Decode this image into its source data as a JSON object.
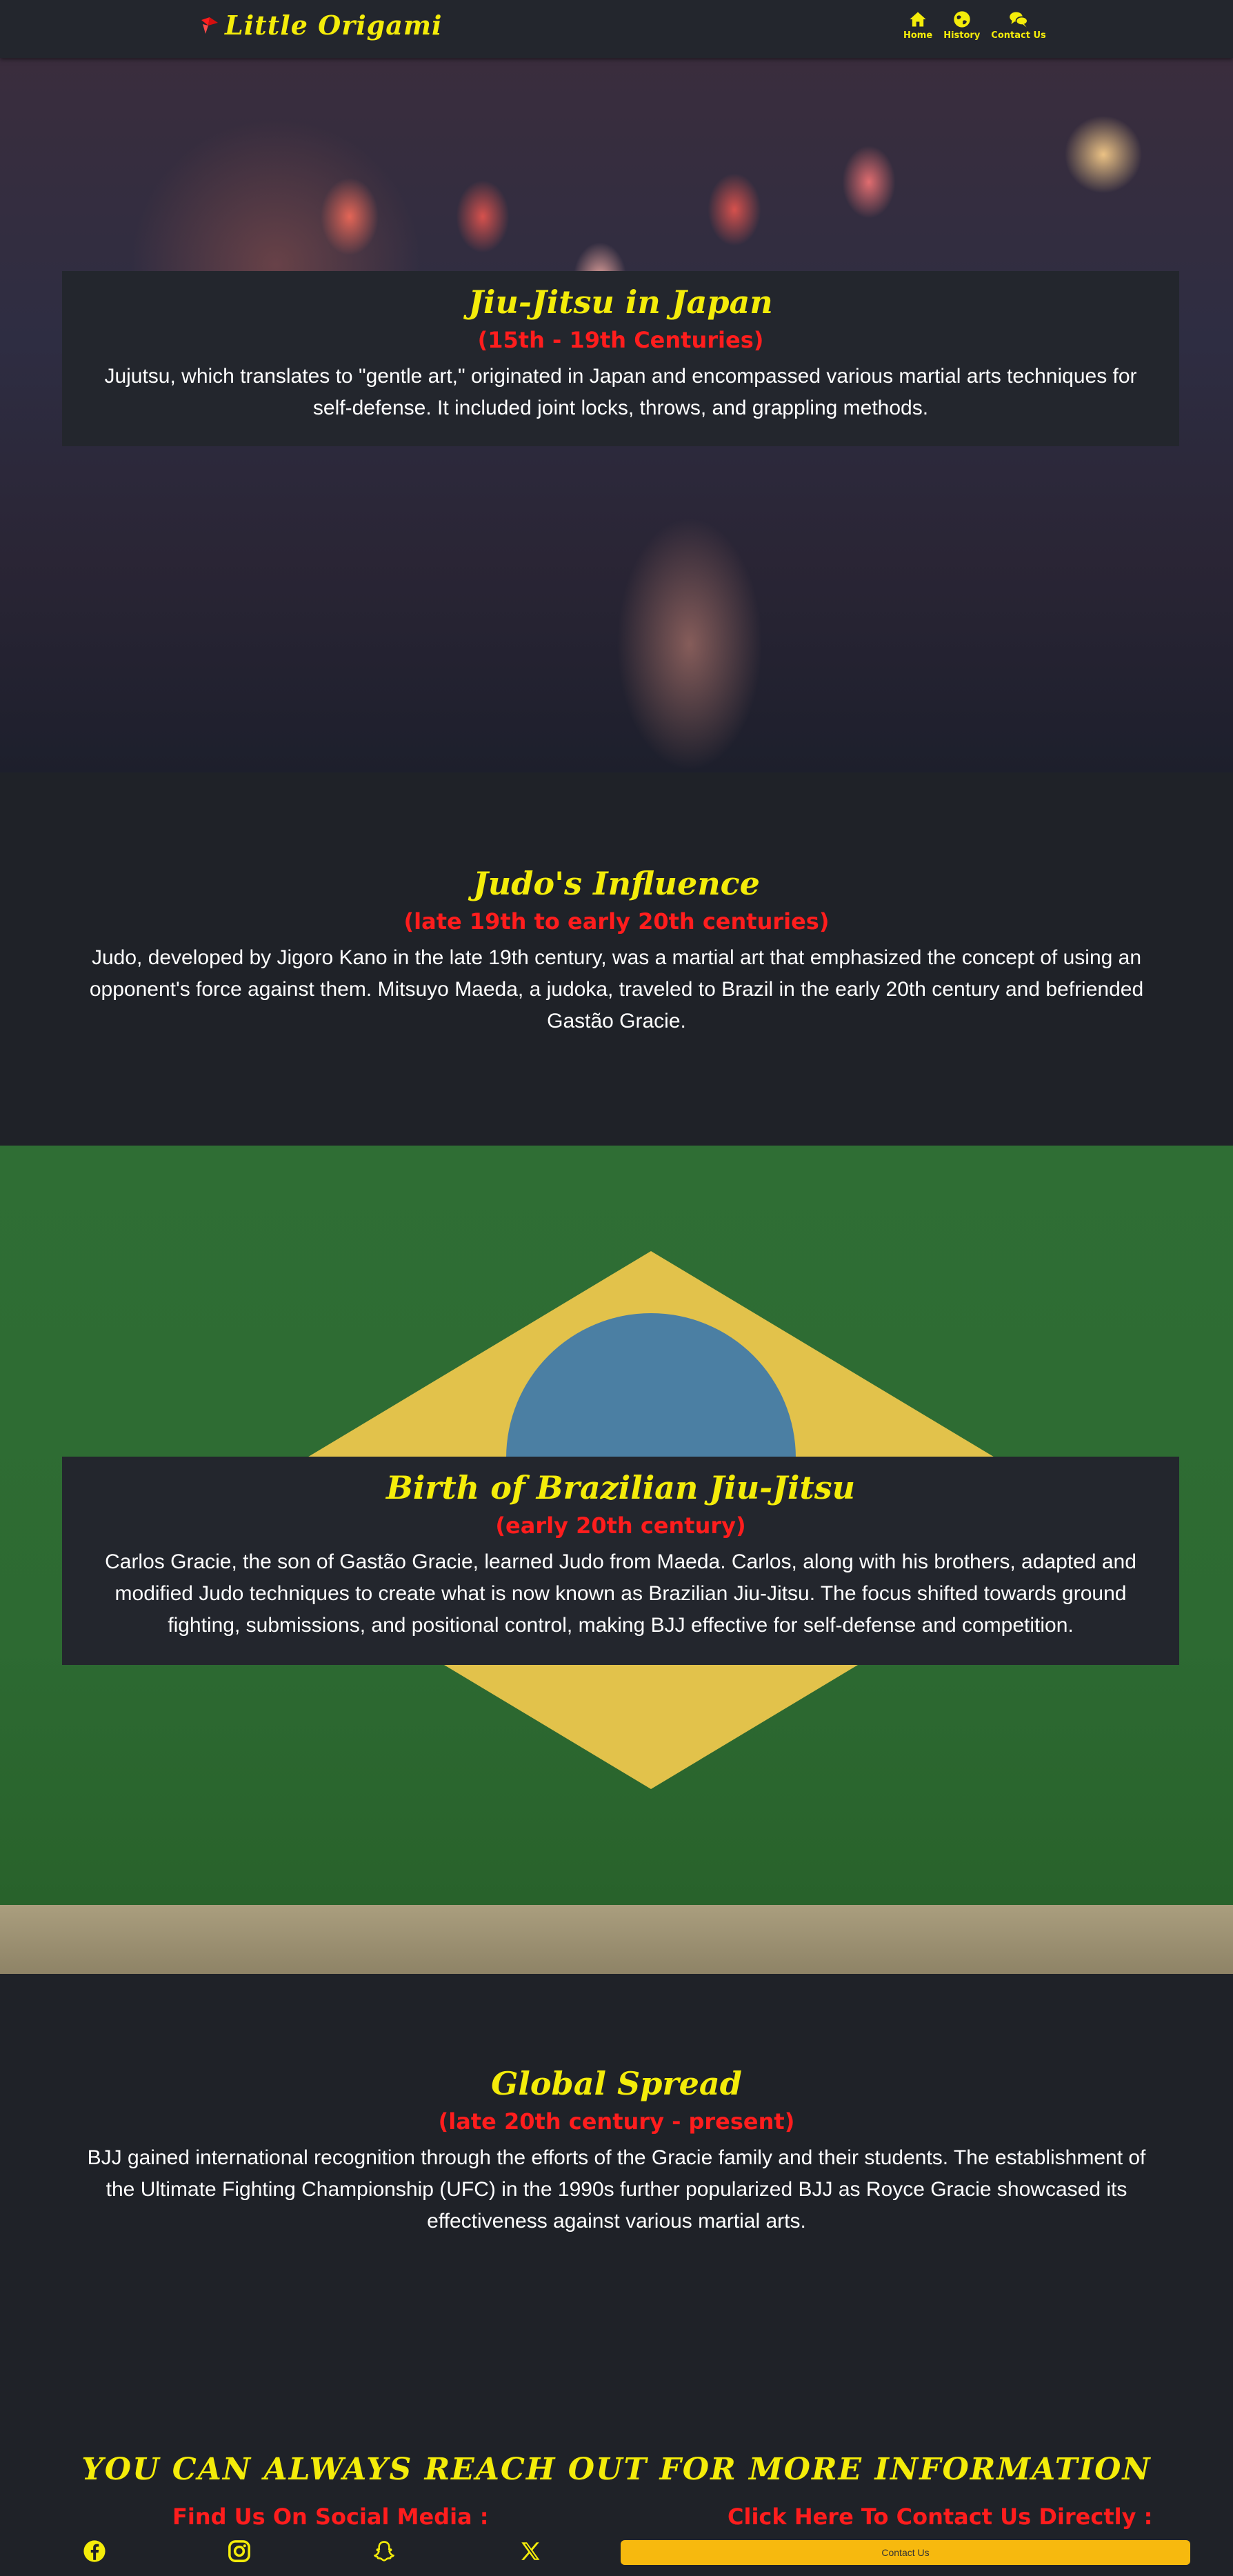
{
  "navbar": {
    "brand": "Little Origami",
    "links": [
      {
        "label": "Home",
        "icon": "home-icon"
      },
      {
        "label": "History",
        "icon": "globe-icon"
      },
      {
        "label": "Contact Us",
        "icon": "chat-bubbles-icon"
      }
    ]
  },
  "sections": [
    {
      "title": "Jiu-Jitsu in Japan",
      "period": "(15th - 19th Centuries)",
      "text": "Jujutsu, which translates to \"gentle art,\" originated in Japan and encompassed various martial arts techniques for self-defense. It included joint locks, throws, and grappling methods."
    },
    {
      "title": "Judo's Influence",
      "period": "(late 19th to early 20th centuries)",
      "text": "Judo, developed by Jigoro Kano in the late 19th century, was a martial art that emphasized the concept of using an opponent's force against them. Mitsuyo Maeda, a judoka, traveled to Brazil in the early 20th century and befriended Gastão Gracie."
    },
    {
      "title": "Birth of Brazilian Jiu-Jitsu",
      "period": "(early 20th century)",
      "text": "Carlos Gracie, the son of Gastão Gracie, learned Judo from Maeda. Carlos, along with his brothers, adapted and modified Judo techniques to create what is now known as Brazilian Jiu-Jitsu. The focus shifted towards ground fighting, submissions, and positional control, making BJJ effective for self-defense and competition."
    },
    {
      "title": "Global Spread",
      "period": "(late 20th century - present)",
      "text": "BJJ gained international recognition through the efforts of the Gracie family and their students. The establishment of the Ultimate Fighting Championship (UFC) in the 1990s further popularized BJJ as Royce Gracie showcased its effectiveness against various martial arts."
    }
  ],
  "footer": {
    "heading": "YOU CAN ALWAYS REACH OUT FOR MORE INFORMATION",
    "social_heading": "Find Us On Social Media :",
    "contact_heading": "Click Here To Contact Us Directly :",
    "contact_button": "Contact Us",
    "social_icons": [
      "facebook-icon",
      "instagram-icon",
      "snapchat-icon",
      "x-icon"
    ]
  },
  "colors": {
    "accent_yellow": "#f4ec0a",
    "accent_red": "#ff1d1d",
    "background": "#1f2228",
    "button": "#f7b90e"
  }
}
